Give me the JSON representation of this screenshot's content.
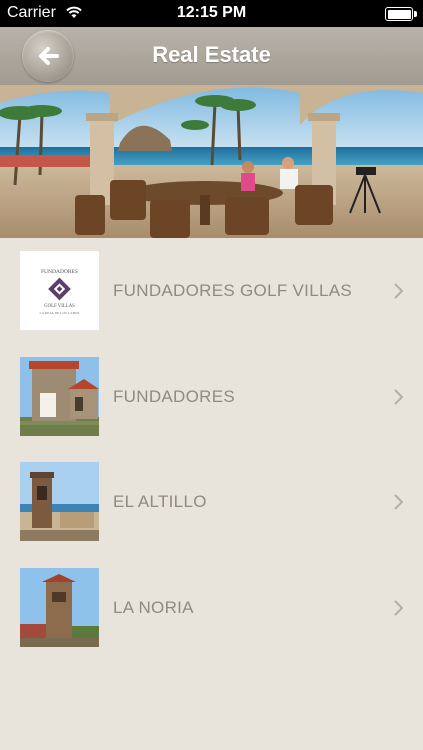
{
  "status_bar": {
    "carrier": "Carrier",
    "time": "12:15 PM"
  },
  "nav": {
    "back_icon": "back-arrow-icon",
    "title": "Real Estate"
  },
  "items": [
    {
      "label": "FUNDADORES GOLF VILLAS",
      "thumb_text": [
        "FUNDADORES",
        "GOLF VILLAS",
        "LA REAL DE LOS CABOS"
      ]
    },
    {
      "label": "FUNDADORES"
    },
    {
      "label": "EL ALTILLO"
    },
    {
      "label": "LA NORIA"
    }
  ],
  "colors": {
    "background": "#e8e4dc",
    "navbar": "#a19b91",
    "label": "#8f8a82",
    "accent_logo": "#5b3f6b"
  }
}
